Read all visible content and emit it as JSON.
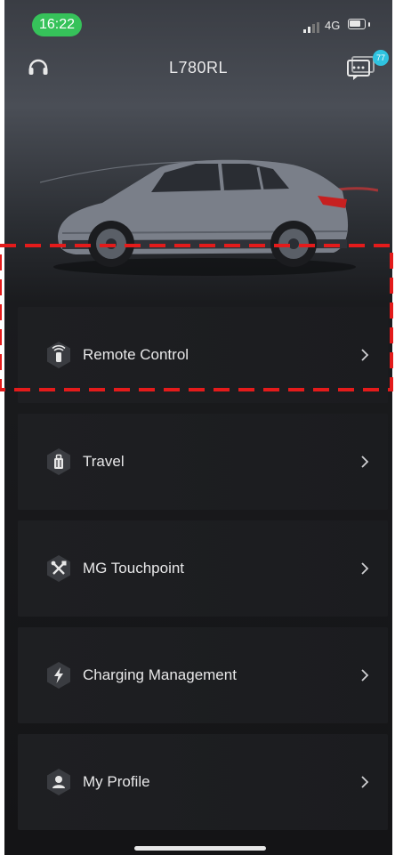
{
  "status_bar": {
    "time": "16:22",
    "network": "4G",
    "icons": [
      "signal-icon",
      "battery-icon"
    ]
  },
  "header": {
    "title": "L780RL",
    "left_icon": "headset-icon",
    "right_icon": "message-icon",
    "badge": "77"
  },
  "menu": [
    {
      "label": "Remote Control",
      "icon": "remote-key-icon"
    },
    {
      "label": "Travel",
      "icon": "luggage-icon"
    },
    {
      "label": "MG Touchpoint",
      "icon": "tools-icon"
    },
    {
      "label": "Charging Management",
      "icon": "lightning-icon"
    },
    {
      "label": "My Profile",
      "icon": "person-icon"
    }
  ],
  "colors": {
    "time_pill": "#36c25a",
    "badge": "#2fc3e0",
    "highlight": "#e41b1b",
    "car_body": "#7a7f89"
  }
}
